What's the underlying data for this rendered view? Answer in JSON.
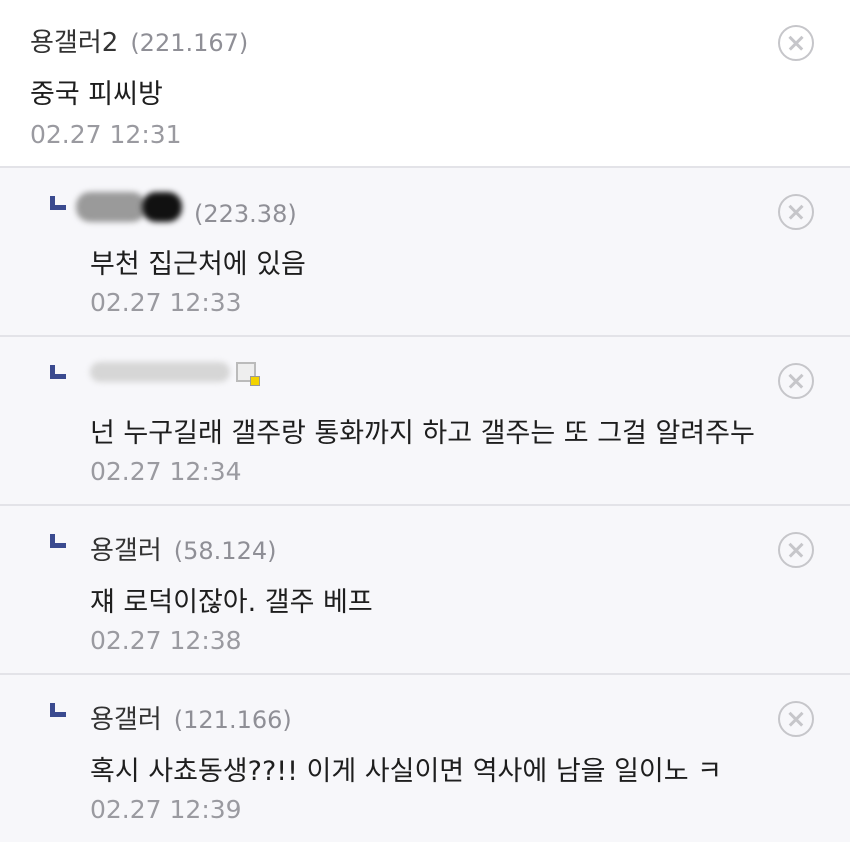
{
  "comments": [
    {
      "nick": "용갤러2",
      "ip": "(221.167)",
      "body": "중국 피씨방",
      "date": "02.27 12:31",
      "is_reply": false
    },
    {
      "nick": "",
      "ip": "(223.38)",
      "body": "부천 집근처에 있음",
      "date": "02.27 12:33",
      "is_reply": true,
      "nick_obscured": true
    },
    {
      "nick": "",
      "ip": "",
      "body": "넌 누구길래 갤주랑 통화까지 하고 갤주는 또 그걸 알려주누",
      "date": "02.27 12:34",
      "is_reply": true,
      "nick_obscured": true
    },
    {
      "nick": "용갤러",
      "ip": "(58.124)",
      "body": "쟤 로덕이잖아. 갤주 베프",
      "date": "02.27 12:38",
      "is_reply": true
    },
    {
      "nick": "용갤러",
      "ip": "(121.166)",
      "body": "혹시 사쵸동생??!! 이게 사실이면 역사에 남을 일이노 ㅋ",
      "date": "02.27 12:39",
      "is_reply": true
    }
  ],
  "icons": {
    "delete": "close-circle-icon",
    "reply": "reply-arrow-icon",
    "user_image": "user-image-icon"
  },
  "colors": {
    "reply_bg": "#f7f7fa",
    "divider": "#e3e3e8",
    "reply_arrow": "#3a4a8f",
    "meta_text": "#8f8f96"
  }
}
